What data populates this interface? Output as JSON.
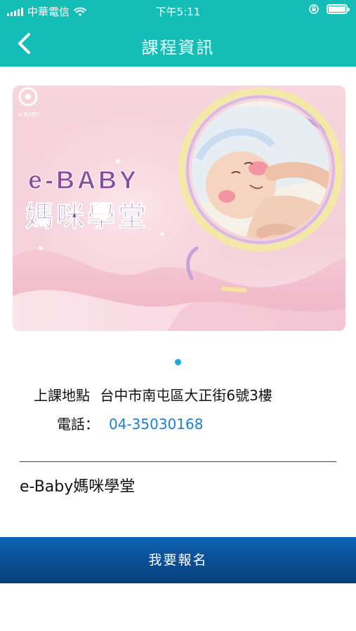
{
  "status_bar": {
    "carrier": "中華電信",
    "time": "下午5:11"
  },
  "nav": {
    "title": "課程資訊",
    "back_icon": "chevron-left-icon"
  },
  "banner": {
    "logo_text": "e-BABY",
    "title_en": "e-BABY",
    "title_zh": "媽咪學堂"
  },
  "info": {
    "location_label": "上課地點",
    "location_value": "台中市南屯區大正街6號3樓",
    "phone_label": "電話：",
    "phone_value": "04-35030168"
  },
  "course_name": "e-Baby媽咪學堂",
  "signup_label": "我要報名",
  "colors": {
    "header": "#14bdb6",
    "link": "#1e7fd8",
    "button": "#0b4f95",
    "banner_title": "#8a4c9e"
  }
}
